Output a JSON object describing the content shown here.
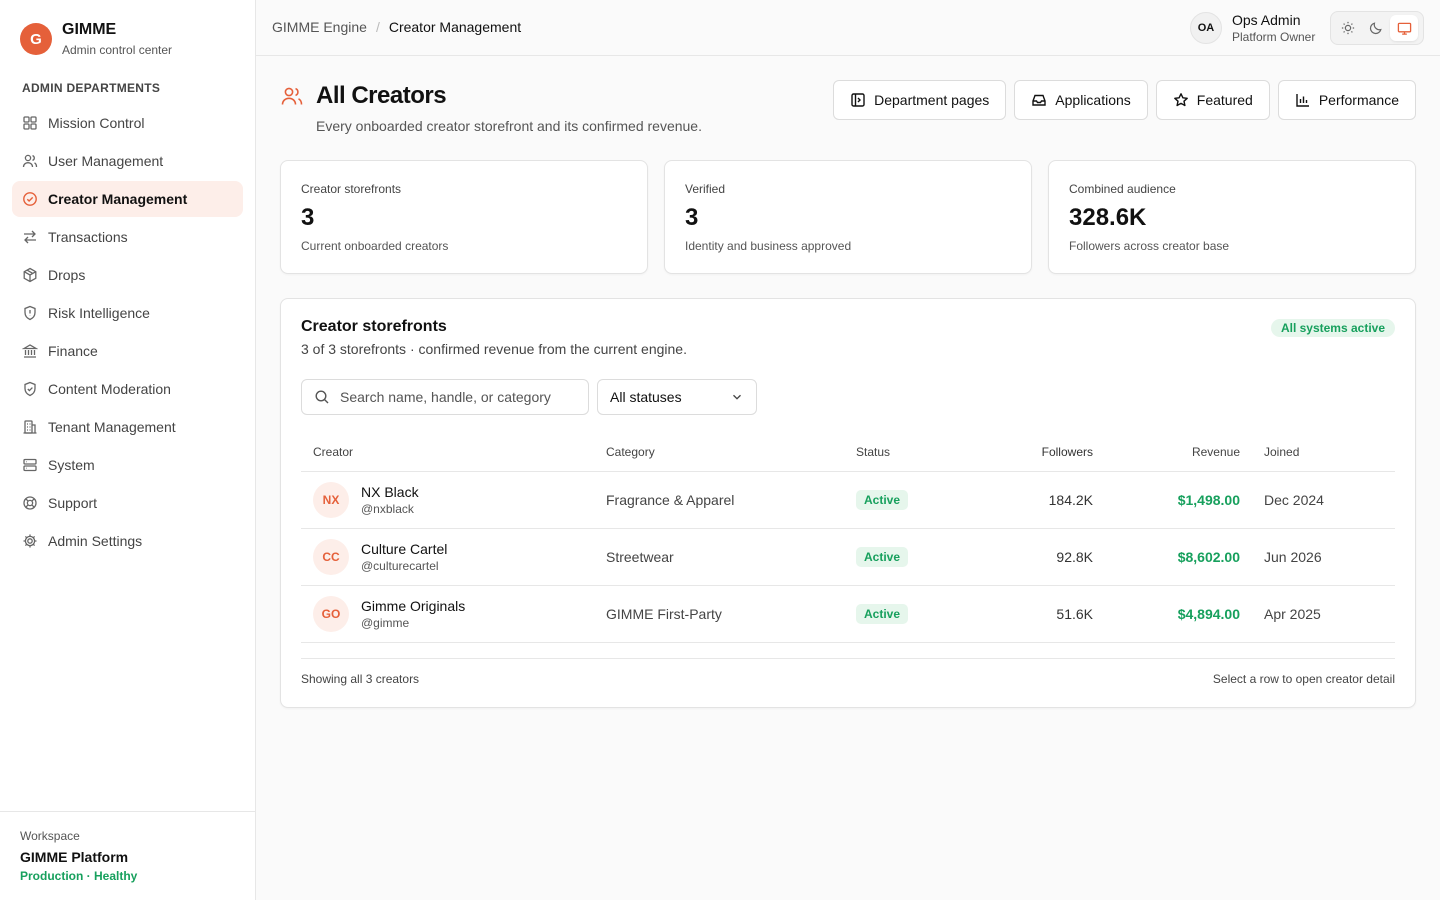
{
  "brand": {
    "logo_letter": "G",
    "name": "GIMME",
    "subtitle": "Admin control center",
    "accent": "#e5603a"
  },
  "sidebar": {
    "heading": "ADMIN DEPARTMENTS",
    "items": [
      {
        "label": "Mission Control",
        "icon": "grid-icon"
      },
      {
        "label": "User Management",
        "icon": "users-icon"
      },
      {
        "label": "Creator Management",
        "icon": "check-circle-icon",
        "active": true
      },
      {
        "label": "Transactions",
        "icon": "arrows-swap-icon"
      },
      {
        "label": "Drops",
        "icon": "package-icon"
      },
      {
        "label": "Risk Intelligence",
        "icon": "shield-alert-icon"
      },
      {
        "label": "Finance",
        "icon": "bank-icon"
      },
      {
        "label": "Content Moderation",
        "icon": "shield-check-icon"
      },
      {
        "label": "Tenant Management",
        "icon": "building-icon"
      },
      {
        "label": "System",
        "icon": "server-icon"
      },
      {
        "label": "Support",
        "icon": "lifebuoy-icon"
      },
      {
        "label": "Admin Settings",
        "icon": "gear-icon"
      }
    ],
    "workspace": {
      "label": "Workspace",
      "name": "GIMME Platform",
      "status": "Production · Healthy",
      "status_color": "#17a05d"
    }
  },
  "topbar": {
    "breadcrumb": {
      "root": "GIMME Engine",
      "separator": "/",
      "current": "Creator Management"
    },
    "user": {
      "initials": "OA",
      "name": "Ops Admin",
      "role": "Platform Owner"
    },
    "theme": {
      "options": [
        "light",
        "dark",
        "system"
      ],
      "selected": "system"
    }
  },
  "header": {
    "icon": "users-icon",
    "title": "All Creators",
    "subtitle": "Every onboarded creator storefront and its confirmed revenue.",
    "actions": [
      {
        "label": "Department pages",
        "icon": "panel-icon"
      },
      {
        "label": "Applications",
        "icon": "inbox-icon"
      },
      {
        "label": "Featured",
        "icon": "star-icon"
      },
      {
        "label": "Performance",
        "icon": "bar-chart-icon"
      }
    ]
  },
  "stats": [
    {
      "label": "Creator storefronts",
      "value": "3",
      "hint": "Current onboarded creators"
    },
    {
      "label": "Verified",
      "value": "3",
      "hint": "Identity and business approved"
    },
    {
      "label": "Combined audience",
      "value": "328.6K",
      "hint": "Followers across creator base"
    }
  ],
  "storefronts": {
    "title": "Creator storefronts",
    "subtitle": "3 of 3 storefronts · confirmed revenue from the current engine.",
    "system_badge": "All systems active",
    "search": {
      "placeholder": "Search name, handle, or category",
      "value": ""
    },
    "status_filter": {
      "selected": "All statuses"
    },
    "columns": [
      "Creator",
      "Category",
      "Status",
      "Followers",
      "Revenue",
      "Joined"
    ],
    "rows": [
      {
        "initials": "NX",
        "name": "NX Black",
        "handle": "@nxblack",
        "category": "Fragrance & Apparel",
        "status": "Active",
        "followers": "184.2K",
        "revenue": "$1,498.00",
        "joined": "Dec 2024"
      },
      {
        "initials": "CC",
        "name": "Culture Cartel",
        "handle": "@culturecartel",
        "category": "Streetwear",
        "status": "Active",
        "followers": "92.8K",
        "revenue": "$8,602.00",
        "joined": "Jun 2026"
      },
      {
        "initials": "GO",
        "name": "Gimme Originals",
        "handle": "@gimme",
        "category": "GIMME First-Party",
        "status": "Active",
        "followers": "51.6K",
        "revenue": "$4,894.00",
        "joined": "Apr 2025"
      }
    ],
    "footer_left": "Showing all 3 creators",
    "footer_right": "Select a row to open creator detail"
  }
}
